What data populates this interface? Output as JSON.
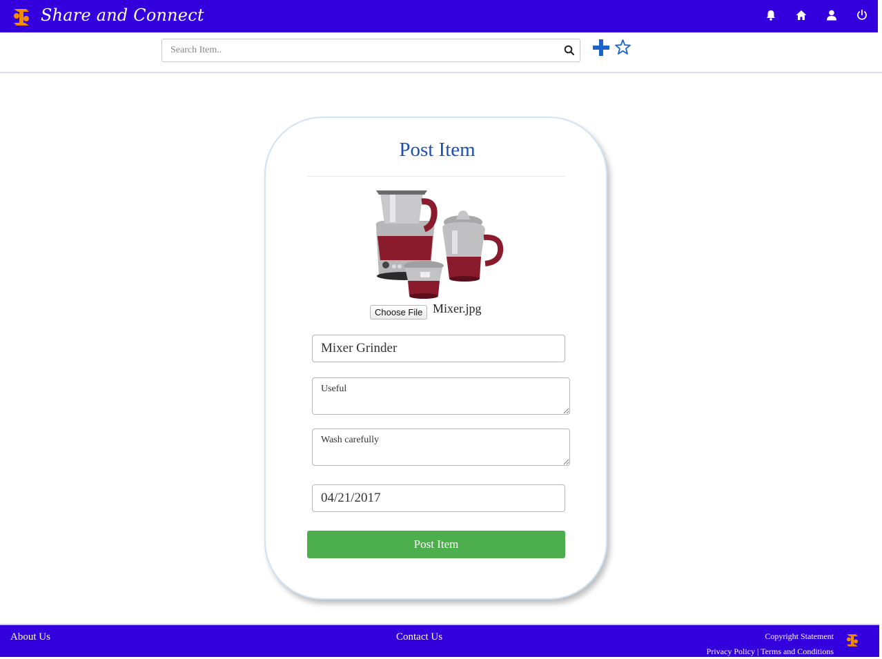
{
  "header": {
    "title": "Share and Connect",
    "logo_icon": "share-hands-logo-icon",
    "icons": [
      "bell-icon",
      "home-icon",
      "user-icon",
      "power-icon"
    ]
  },
  "search": {
    "placeholder": "Search Item..",
    "icon": "search-icon",
    "actions": [
      "plus-icon",
      "star-icon"
    ]
  },
  "form": {
    "title": "Post Item",
    "choose_file_label": "Choose File",
    "file_name": "Mixer.jpg",
    "item_name": "Mixer Grinder",
    "description": "Useful",
    "instructions": "Wash carefully",
    "date": "04/21/2017",
    "submit_label": "Post Item"
  },
  "footer": {
    "about": "About Us",
    "contact": "Contact Us",
    "copyright": "Copyright Statement",
    "legal": "Privacy Policy | Terms and Conditions"
  },
  "colors": {
    "nav_bg": "#3300dd",
    "title_blue": "#1a4fb8",
    "submit_green": "#4cae4c",
    "logo_orange": "#f28c00"
  }
}
